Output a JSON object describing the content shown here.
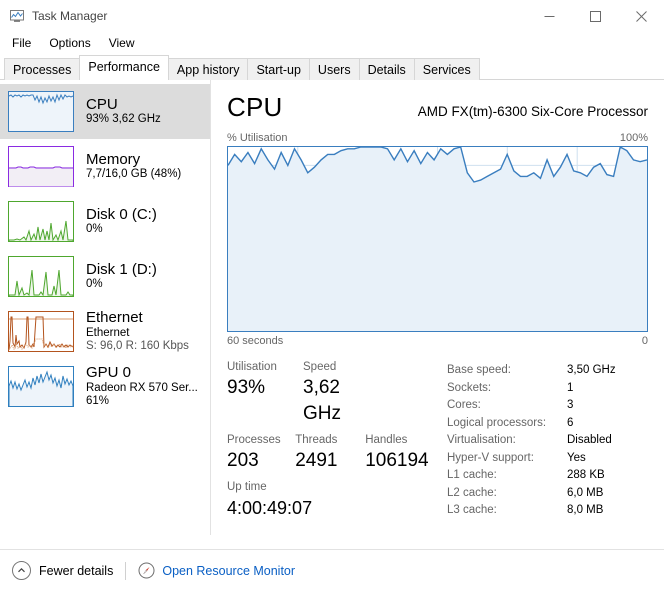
{
  "window": {
    "title": "Task Manager",
    "icon": "task-manager-icon",
    "minimize": "minimize-icon",
    "maximize": "maximize-icon",
    "close": "close-icon"
  },
  "menu": {
    "items": [
      {
        "label": "File"
      },
      {
        "label": "Options"
      },
      {
        "label": "View"
      }
    ]
  },
  "tabs": {
    "items": [
      {
        "label": "Processes",
        "active": false
      },
      {
        "label": "Performance",
        "active": true
      },
      {
        "label": "App history",
        "active": false
      },
      {
        "label": "Start-up",
        "active": false
      },
      {
        "label": "Users",
        "active": false
      },
      {
        "label": "Details",
        "active": false
      },
      {
        "label": "Services",
        "active": false
      }
    ]
  },
  "sidebar": {
    "items": [
      {
        "name": "CPU",
        "title": "CPU",
        "sub1": "93%  3,62 GHz",
        "sub2": "",
        "selected": true,
        "color": "#3a7ebf",
        "fill": "#eef4fa"
      },
      {
        "name": "Memory",
        "title": "Memory",
        "sub1": "7,7/16,0 GB (48%)",
        "sub2": "",
        "selected": false,
        "color": "#8a2be2",
        "fill": "#f2eef5"
      },
      {
        "name": "Disk 0 (C:)",
        "title": "Disk 0 (C:)",
        "sub1": "0%",
        "sub2": "",
        "selected": false,
        "color": "#4ea72e",
        "fill": "#eef6ea"
      },
      {
        "name": "Disk 1 (D:)",
        "title": "Disk 1 (D:)",
        "sub1": "0%",
        "sub2": "",
        "selected": false,
        "color": "#4ea72e",
        "fill": "#eef6ea"
      },
      {
        "name": "Ethernet",
        "title": "Ethernet",
        "sub1": "Ethernet",
        "sub2": "S: 96,0 R: 160 Kbps",
        "selected": false,
        "color": "#b3541e",
        "fill": "#f8f0ea"
      },
      {
        "name": "GPU 0",
        "title": "GPU 0",
        "sub1": "Radeon RX 570 Ser...",
        "sub2": "61%",
        "selected": false,
        "color": "#2f7fbf",
        "fill": "#eef4fa"
      }
    ]
  },
  "main": {
    "title": "CPU",
    "model": "AMD FX(tm)-6300 Six-Core Processor",
    "axis_top_left": "% Utilisation",
    "axis_top_right": "100%",
    "axis_bottom_left": "60 seconds",
    "axis_bottom_right": "0",
    "stats": {
      "utilisation_label": "Utilisation",
      "utilisation_value": "93%",
      "speed_label": "Speed",
      "speed_value": "3,62 GHz",
      "processes_label": "Processes",
      "processes_value": "203",
      "threads_label": "Threads",
      "threads_value": "2491",
      "handles_label": "Handles",
      "handles_value": "106194",
      "uptime_label": "Up time",
      "uptime_value": "4:00:49:07"
    },
    "specs": [
      {
        "key": "Base speed:",
        "value": "3,50 GHz"
      },
      {
        "key": "Sockets:",
        "value": "1"
      },
      {
        "key": "Cores:",
        "value": "3"
      },
      {
        "key": "Logical processors:",
        "value": "6"
      },
      {
        "key": "Virtualisation:",
        "value": "Disabled"
      },
      {
        "key": "Hyper-V support:",
        "value": "Yes"
      },
      {
        "key": "L1 cache:",
        "value": "288 KB"
      },
      {
        "key": "L2 cache:",
        "value": "6,0 MB"
      },
      {
        "key": "L3 cache:",
        "value": "8,0 MB"
      }
    ]
  },
  "footer": {
    "fewer_details_label": "Fewer details",
    "fewer_details_icon": "chevron-up-icon",
    "resource_monitor_label": "Open Resource Monitor",
    "resource_monitor_icon": "resource-monitor-icon"
  },
  "colors": {
    "accent": "#3a7ebf",
    "graph_line": "#3a7ebf",
    "graph_fill": "#eaf2f9",
    "link": "#0a5fc4",
    "selected_row": "#dcdcdc"
  },
  "chart_data": {
    "type": "area",
    "title": "CPU % Utilisation over time",
    "xlabel": "60 seconds",
    "ylabel": "% Utilisation",
    "ylim": [
      0,
      100
    ],
    "xlim": [
      0,
      60
    ],
    "grid": true,
    "gridlines_x": 6,
    "gridlines_y": 10,
    "series_name": "% Utilisation",
    "values": [
      90,
      96,
      92,
      97,
      91,
      99,
      93,
      88,
      97,
      90,
      99,
      93,
      86,
      89,
      93,
      96,
      96,
      98,
      99,
      99,
      100,
      100,
      100,
      100,
      99,
      93,
      99,
      92,
      98,
      91,
      97,
      93,
      99,
      96,
      99,
      100,
      86,
      81,
      82,
      84,
      86,
      88,
      96,
      87,
      84,
      84,
      86,
      83,
      93,
      84,
      89,
      96,
      87,
      86,
      84,
      89,
      91,
      85,
      84,
      100,
      98,
      93,
      91,
      92
    ]
  }
}
